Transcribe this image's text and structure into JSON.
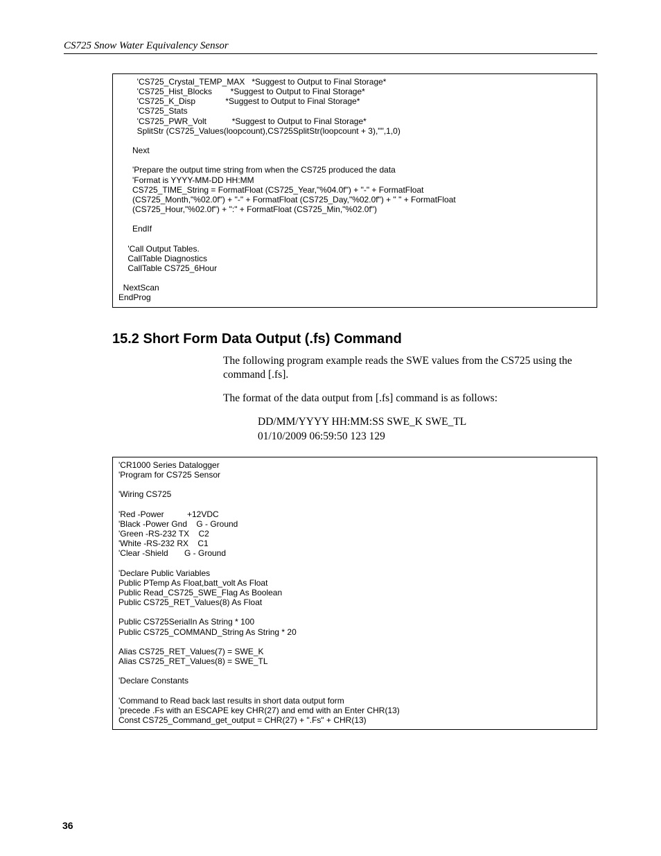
{
  "header": "CS725 Snow Water Equivalency Sensor",
  "code_block_1": "        'CS725_Crystal_TEMP_MAX   *Suggest to Output to Final Storage*\n        'CS725_Hist_Blocks        *Suggest to Output to Final Storage*\n        'CS725_K_Disp             *Suggest to Output to Final Storage*\n        'CS725_Stats\n        'CS725_PWR_Volt           *Suggest to Output to Final Storage*\n        SplitStr (CS725_Values(loopcount),CS725SplitStr(loopcount + 3),\"\",1,0)\n\n      Next\n\n      'Prepare the output time string from when the CS725 produced the data\n      'Format is YYYY-MM-DD HH:MM\n      CS725_TIME_String = FormatFloat (CS725_Year,\"%04.0f\") + \"-\" + FormatFloat\n      (CS725_Month,\"%02.0f\") + \"-\" + FormatFloat (CS725_Day,\"%02.0f\") + \" \" + FormatFloat\n      (CS725_Hour,\"%02.0f\") + \":\" + FormatFloat (CS725_Min,\"%02.0f\")\n\n      EndIf\n\n    'Call Output Tables.\n    CallTable Diagnostics\n    CallTable CS725_6Hour\n\n  NextScan\nEndProg",
  "section_heading": "15.2  Short Form Data Output (.fs) Command",
  "paragraph_1": "The following program example reads the SWE values from the CS725 using the command [.fs].",
  "paragraph_2": "The format of the data output from [.fs] command is as follows:",
  "format_line_1": "DD/MM/YYYY HH:MM:SS SWE_K SWE_TL",
  "format_line_2": "01/10/2009 06:59:50 123 129",
  "code_block_2": "'CR1000 Series Datalogger\n'Program for CS725 Sensor\n\n'Wiring CS725\n\n'Red -Power          +12VDC\n'Black -Power Gnd    G - Ground\n'Green -RS-232 TX    C2\n'White -RS-232 RX    C1\n'Clear -Shield       G - Ground\n\n'Declare Public Variables\nPublic PTemp As Float,batt_volt As Float\nPublic Read_CS725_SWE_Flag As Boolean\nPublic CS725_RET_Values(8) As Float\n\nPublic CS725SerialIn As String * 100\nPublic CS725_COMMAND_String As String * 20\n\nAlias CS725_RET_Values(7) = SWE_K\nAlias CS725_RET_Values(8) = SWE_TL\n\n'Declare Constants\n\n'Command to Read back last results in short data output form\n'precede .Fs with an ESCAPE key CHR(27) and emd with an Enter CHR(13)\nConst CS725_Command_get_output = CHR(27) + \".Fs\" + CHR(13)\n",
  "page_number": "36"
}
